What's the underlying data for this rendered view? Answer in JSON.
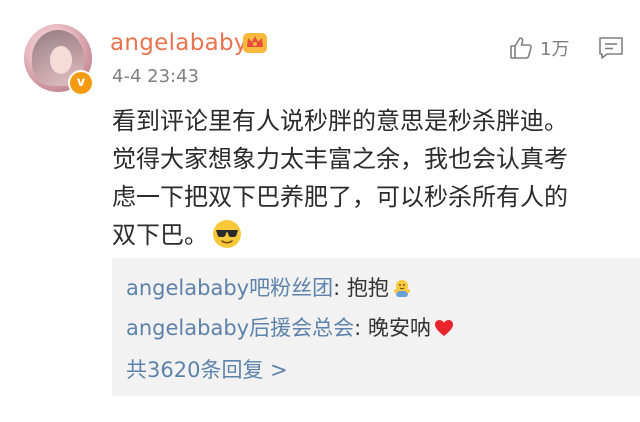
{
  "post": {
    "username": "angelababy",
    "timestamp": "4-4 23:43",
    "like_count": "1万",
    "content": "看到评论里有人说秒胖的意思是秒杀胖迪。觉得大家想象力太丰富之余，我也会认真考虑一下把双下巴养肥了，可以秒杀所有人的双下巴。",
    "colors": {
      "username": "#eb7350",
      "link": "#5d83ab",
      "verified_badge": "#f39c12",
      "reply_bg": "#f2f2f2"
    },
    "icons": {
      "verified": "verified-v-badge",
      "member": "crown-member-icon",
      "like": "thumbs-up-icon",
      "comment": "comment-bubble-icon",
      "content_emoji": "sunglasses-emoji"
    }
  },
  "replies": {
    "items": [
      {
        "author": "angelababy吧粉丝团",
        "separator": ": ",
        "text": "抱抱",
        "emoji": "hug-emoji"
      },
      {
        "author": "angelababy后援会总会",
        "separator": ": ",
        "text": "晚安呐",
        "emoji": "red-heart-emoji"
      }
    ],
    "more_label": "共3620条回复 >"
  }
}
